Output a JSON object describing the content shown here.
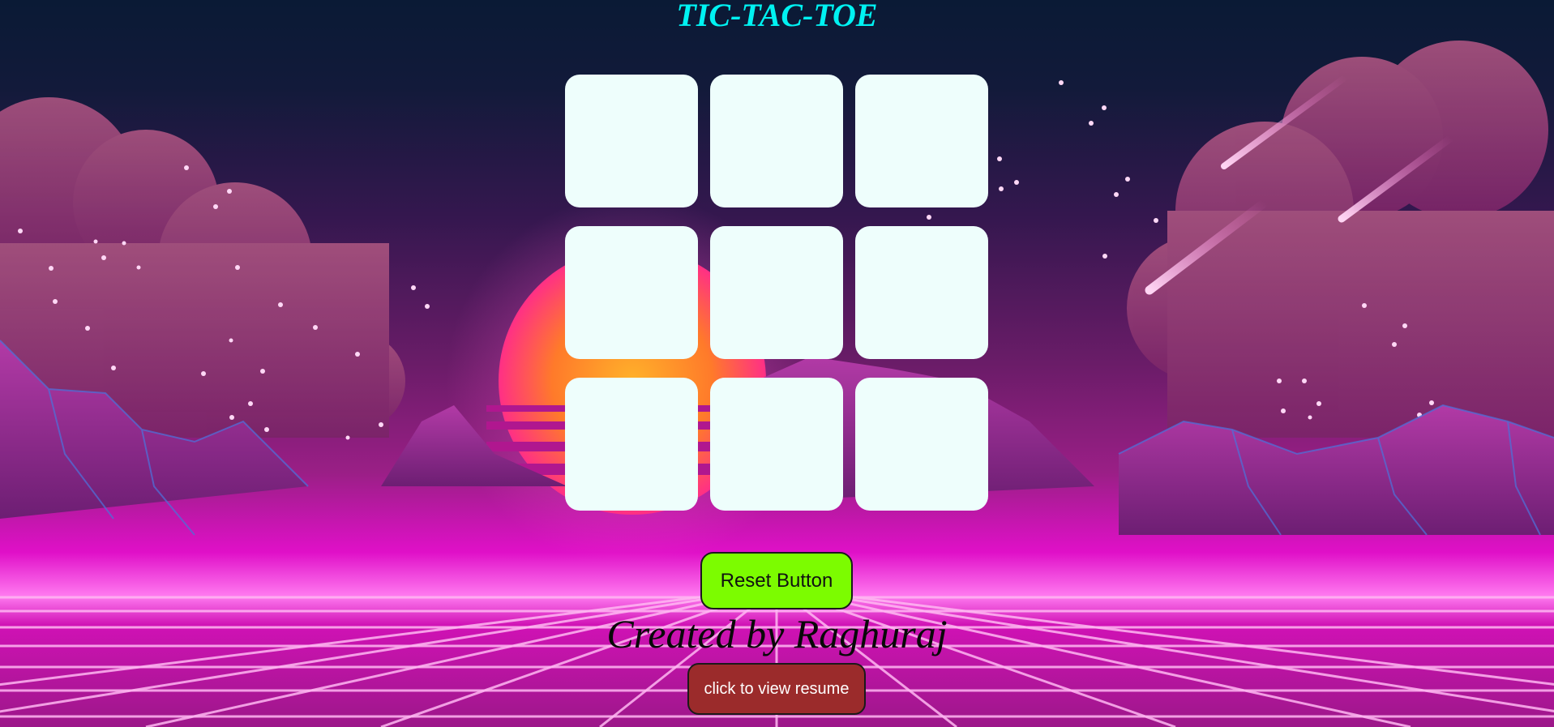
{
  "header": {
    "title": "TIC-TAC-TOE"
  },
  "board": {
    "cells": [
      "",
      "",
      "",
      "",
      "",
      "",
      "",
      "",
      ""
    ]
  },
  "controls": {
    "reset_label": "Reset Button"
  },
  "footer": {
    "credit": "Created by Raghuraj",
    "resume_label": "click to view resume"
  },
  "colors": {
    "title": "#00f2f2",
    "cell": "#eefefc",
    "reset_button": "#7cfc00",
    "resume_button": "#9b2b2b",
    "background_top": "#0c1834",
    "background_accent": "#ff00c8"
  }
}
